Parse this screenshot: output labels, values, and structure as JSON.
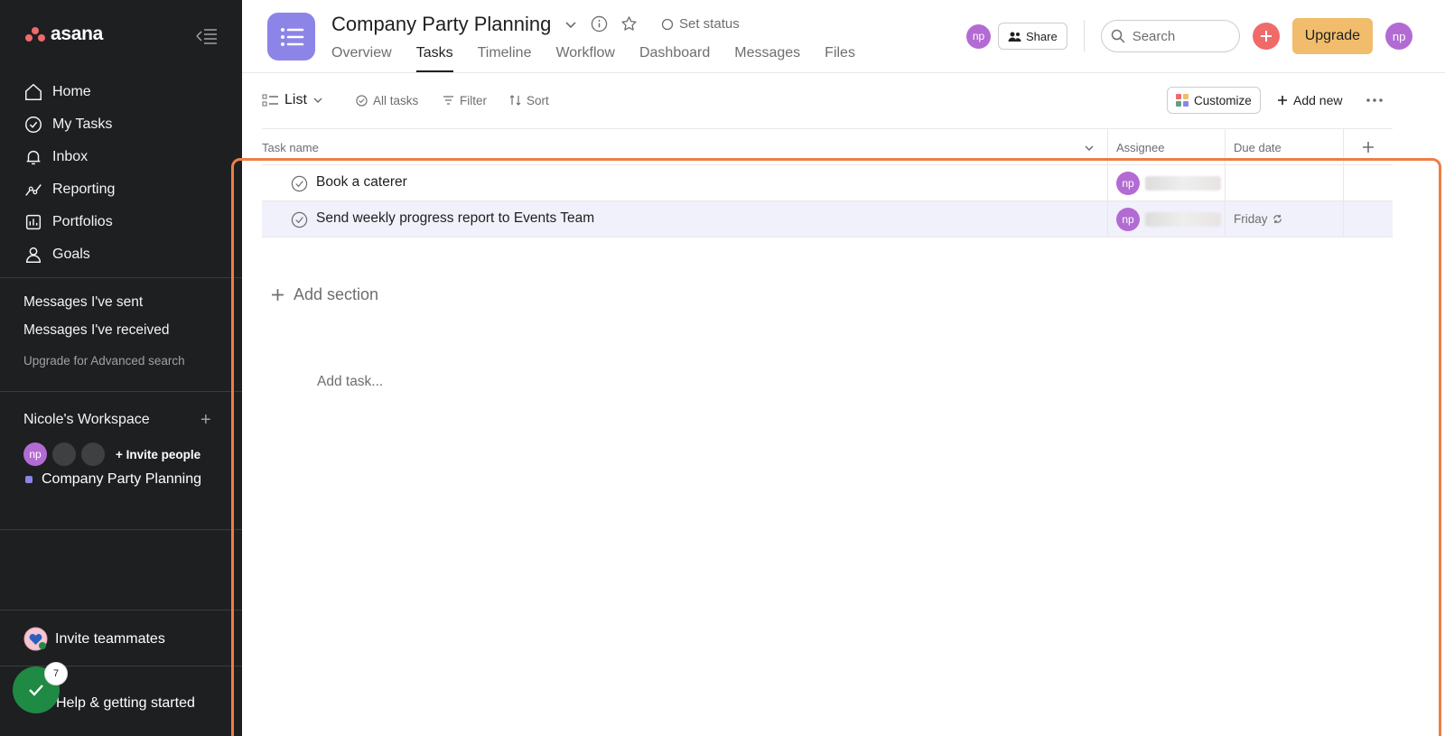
{
  "app": {
    "name": "asana"
  },
  "sidebar": {
    "nav": [
      {
        "label": "Home",
        "icon": "home-icon"
      },
      {
        "label": "My Tasks",
        "icon": "check-circle-icon"
      },
      {
        "label": "Inbox",
        "icon": "bell-icon"
      },
      {
        "label": "Reporting",
        "icon": "reporting-icon"
      },
      {
        "label": "Portfolios",
        "icon": "portfolio-icon"
      },
      {
        "label": "Goals",
        "icon": "goals-icon"
      }
    ],
    "messages": {
      "sent": "Messages I've sent",
      "received": "Messages I've received",
      "upgrade": "Upgrade for Advanced search"
    },
    "workspace": {
      "title": "Nicole's Workspace",
      "avatar": "np",
      "invite": "Invite people",
      "project": "Company Party Planning"
    },
    "invite_teammates": "Invite teammates",
    "help": {
      "label": "Help & getting started",
      "badge": "7"
    }
  },
  "header": {
    "title": "Company Party Planning",
    "set_status": "Set status",
    "tabs": [
      "Overview",
      "Tasks",
      "Timeline",
      "Workflow",
      "Dashboard",
      "Messages",
      "Files"
    ],
    "active_tab": "Tasks",
    "avatar": "np",
    "share": "Share",
    "search_placeholder": "Search",
    "upgrade": "Upgrade",
    "user_avatar": "np"
  },
  "toolbar": {
    "view": "List",
    "all_tasks": "All tasks",
    "filter": "Filter",
    "sort": "Sort",
    "customize": "Customize",
    "add_new": "Add new"
  },
  "table": {
    "columns": {
      "task": "Task name",
      "assignee": "Assignee",
      "due": "Due date"
    },
    "rows": [
      {
        "name": "Book a caterer",
        "assignee": "np",
        "due": ""
      },
      {
        "name": "Send weekly progress report to Events Team",
        "assignee": "np",
        "due": "Friday"
      }
    ],
    "add_task": "Add task...",
    "add_section": "Add section"
  },
  "colors": {
    "sidebar": "#1e1f21",
    "project": "#8d84e8",
    "avatar": "#b36bd4",
    "upgrade": "#f1bd6c",
    "highlight_frame": "#ee7d47"
  }
}
